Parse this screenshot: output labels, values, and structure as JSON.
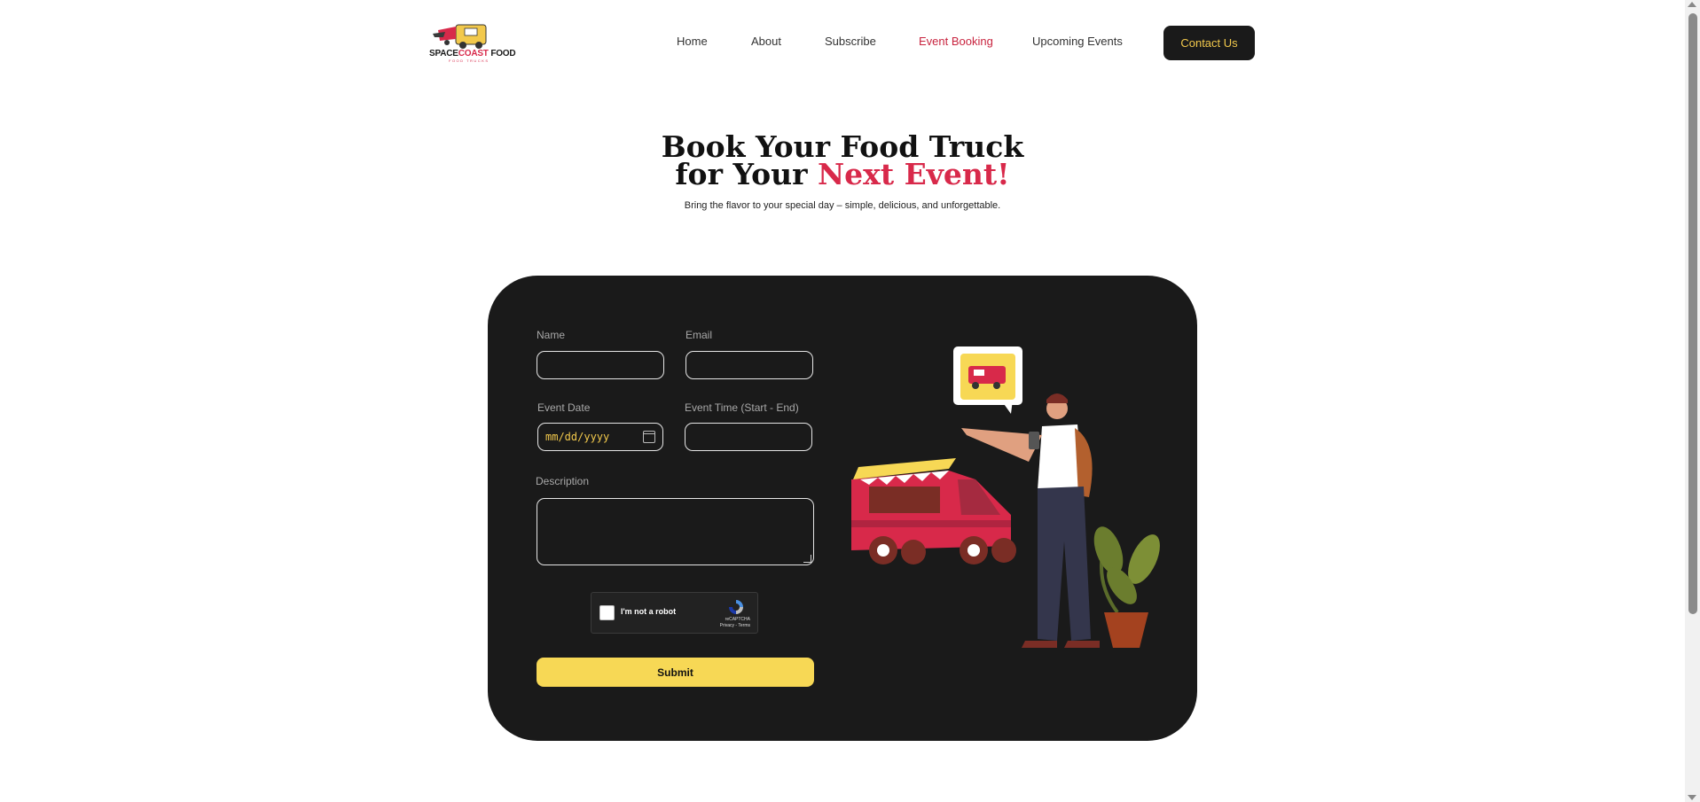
{
  "header": {
    "logo": {
      "brand_part1": "SPACE",
      "brand_part2": "COAST",
      "brand_part3": " FOOD",
      "sub": "FOOD TRUCKS"
    },
    "nav": [
      {
        "label": "Home",
        "active": false
      },
      {
        "label": "About",
        "active": false
      },
      {
        "label": "Subscribe",
        "active": false
      },
      {
        "label": "Event Booking",
        "active": true
      },
      {
        "label": "Upcoming Events",
        "active": false
      }
    ],
    "contact_label": "Contact Us"
  },
  "hero": {
    "title_line1": "Book Your Food Truck",
    "title_line2_prefix": "for Your ",
    "title_line2_accent": "Next Event!",
    "subtitle": "Bring the flavor to your special day – simple, delicious, and unforgettable."
  },
  "form": {
    "name_label": "Name",
    "name_value": "",
    "email_label": "Email",
    "email_value": "",
    "date_label": "Event Date",
    "date_placeholder": "mm/dd/yyyy",
    "time_label": "Event Time (Start - End)",
    "time_value": "",
    "description_label": "Description",
    "description_value": "",
    "recaptcha": {
      "label": "I'm not a robot",
      "brand": "reCAPTCHA",
      "links": "Privacy - Terms"
    },
    "submit_label": "Submit"
  },
  "colors": {
    "accent": "#d8294a",
    "dark": "#1a1a1a",
    "button_yellow": "#f7d855",
    "contact_text": "#f2c94c"
  },
  "icons": [
    "calendar-icon",
    "recaptcha-icon",
    "food-truck-icon"
  ]
}
